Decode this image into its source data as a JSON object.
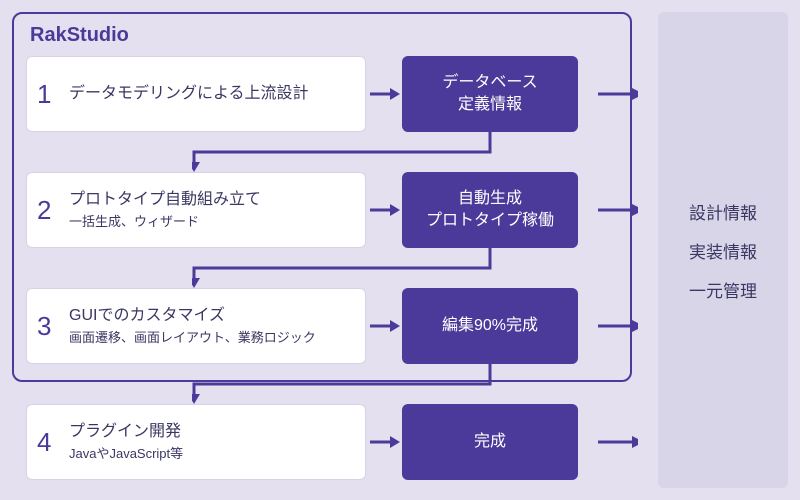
{
  "container_title": "RakStudio",
  "steps": [
    {
      "num": "1",
      "title": "データモデリングによる上流設計",
      "sub": "",
      "output_line1": "データベース",
      "output_line2": "定義情報"
    },
    {
      "num": "2",
      "title": "プロトタイプ自動組み立て",
      "sub": "一括生成、ウィザード",
      "output_line1": "自動生成",
      "output_line2": "プロトタイプ稼働"
    },
    {
      "num": "3",
      "title": "GUIでのカスタマイズ",
      "sub": "画面遷移、画面レイアウト、業務ロジック",
      "output_line1": "編集90%完成",
      "output_line2": ""
    },
    {
      "num": "4",
      "title": "プラグイン開発",
      "sub": "JavaやJavaScript等",
      "output_line1": "完成",
      "output_line2": ""
    }
  ],
  "sidebar": {
    "line1": "設計情報",
    "line2": "実装情報",
    "line3": "一元管理"
  }
}
